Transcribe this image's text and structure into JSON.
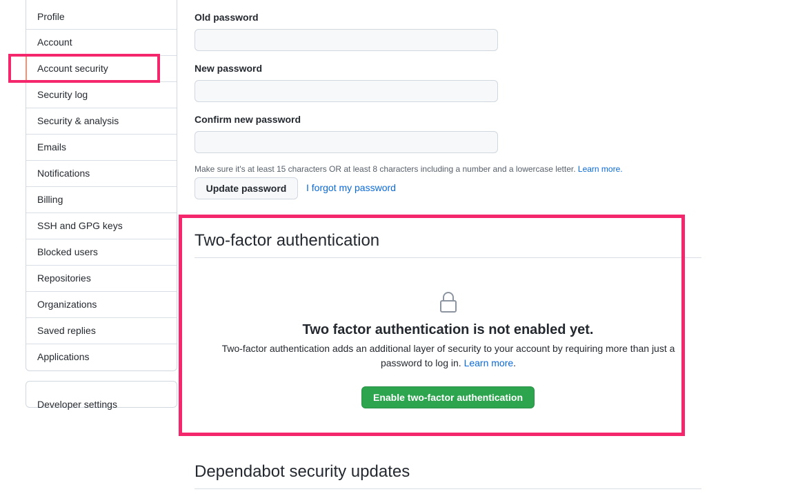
{
  "sidebar": {
    "items": [
      {
        "label": "Profile"
      },
      {
        "label": "Account"
      },
      {
        "label": "Account security"
      },
      {
        "label": "Security log"
      },
      {
        "label": "Security & analysis"
      },
      {
        "label": "Emails"
      },
      {
        "label": "Notifications"
      },
      {
        "label": "Billing"
      },
      {
        "label": "SSH and GPG keys"
      },
      {
        "label": "Blocked users"
      },
      {
        "label": "Repositories"
      },
      {
        "label": "Organizations"
      },
      {
        "label": "Saved replies"
      },
      {
        "label": "Applications"
      }
    ],
    "selected_index": 2,
    "developer_settings": "Developer settings"
  },
  "password_form": {
    "old_password_label": "Old password",
    "new_password_label": "New password",
    "confirm_password_label": "Confirm new password",
    "old_password_value": "",
    "new_password_value": "",
    "confirm_password_value": "",
    "hint": "Make sure it's at least 15 characters OR at least 8 characters including a number and a lowercase letter.",
    "hint_link": "Learn more.",
    "update_button": "Update password",
    "forgot_link": "I forgot my password"
  },
  "two_factor": {
    "title": "Two-factor authentication",
    "heading": "Two factor authentication is not enabled yet.",
    "description": "Two-factor authentication adds an additional layer of security to your account by requiring more than just a password to log in.",
    "learn_more": "Learn more",
    "learn_more_suffix": ".",
    "enable_button": "Enable two-factor authentication",
    "icon": "lock-icon"
  },
  "dependabot": {
    "title": "Dependabot security updates"
  },
  "colors": {
    "highlight": "#f5276c",
    "accent_link": "#0969da",
    "primary_button": "#2da44e",
    "selected_marker": "#fd8c73"
  }
}
